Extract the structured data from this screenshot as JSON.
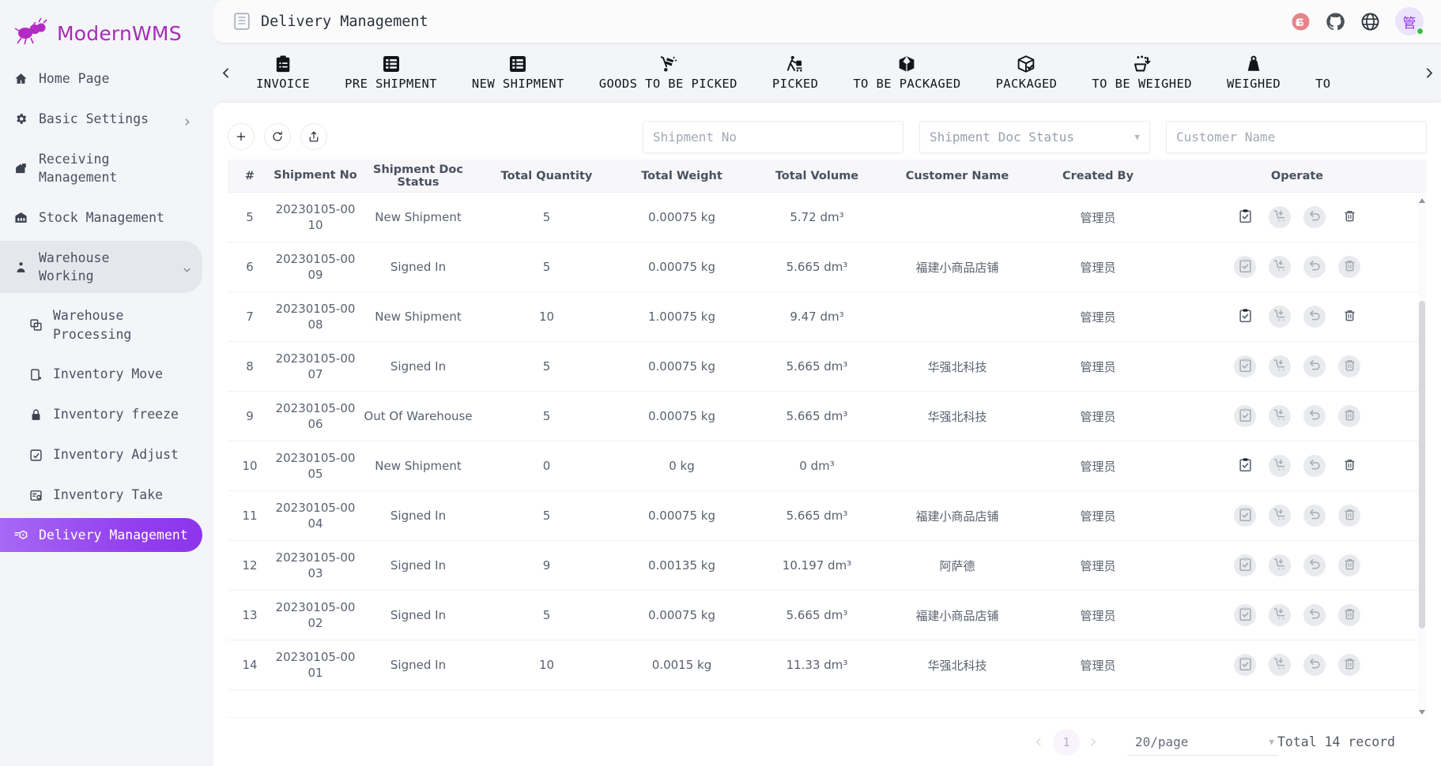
{
  "brand": {
    "name": "ModernWMS",
    "logo_icon": "ant-logo-icon",
    "accent": "#a82bb8"
  },
  "sidebar": {
    "items": [
      {
        "label": "Home Page",
        "icon": "home-icon",
        "state": "normal"
      },
      {
        "label": "Basic Settings",
        "icon": "gear-icon",
        "state": "normal",
        "caret": "chevron-right-icon"
      },
      {
        "label": "Receiving Management",
        "icon": "warehouse-in-icon",
        "state": "normal"
      },
      {
        "label": "Stock Management",
        "icon": "warehouse-icon",
        "state": "normal"
      },
      {
        "label": "Warehouse Working",
        "icon": "worker-icon",
        "state": "expanded",
        "caret": "chevron-down-icon"
      },
      {
        "label": "Warehouse Processing",
        "icon": "copy-icon",
        "state": "sub"
      },
      {
        "label": "Inventory Move",
        "icon": "move-icon",
        "state": "sub"
      },
      {
        "label": "Inventory freeze",
        "icon": "lock-icon",
        "state": "sub"
      },
      {
        "label": "Inventory Adjust",
        "icon": "adjust-icon",
        "state": "sub"
      },
      {
        "label": "Inventory Take",
        "icon": "take-icon",
        "state": "sub"
      },
      {
        "label": "Delivery Management",
        "icon": "delivery-icon",
        "state": "active"
      }
    ],
    "active_accent": "#9340ee"
  },
  "topbar": {
    "title": "Delivery Management",
    "title_icon": "document-icon",
    "icons": [
      {
        "name": "gitee-icon",
        "color": "#e8838b"
      },
      {
        "name": "github-icon",
        "color": "#4b5159"
      },
      {
        "name": "language-globe-icon",
        "color": "#2f343d"
      }
    ],
    "avatar_text": "管",
    "avatar_status": "online"
  },
  "tabs": {
    "prev_icon": "chevron-left-icon",
    "next_icon": "chevron-right-icon",
    "items": [
      {
        "label": "INVOICE",
        "icon": "clipboard-list-icon",
        "active": true
      },
      {
        "label": "PRE SHIPMENT",
        "icon": "list-grid-icon",
        "active": false
      },
      {
        "label": "NEW SHIPMENT",
        "icon": "list-grid-icon",
        "active": false
      },
      {
        "label": "GOODS TO BE PICKED",
        "icon": "hand-truck-icon",
        "active": false
      },
      {
        "label": "PICKED",
        "icon": "worker-cart-icon",
        "active": false
      },
      {
        "label": "TO BE PACKAGED",
        "icon": "open-box-icon",
        "active": false
      },
      {
        "label": "PACKAGED",
        "icon": "box-check-icon",
        "active": false
      },
      {
        "label": "TO BE WEIGHED",
        "icon": "scale-in-icon",
        "active": false
      },
      {
        "label": "WEIGHED",
        "icon": "weight-icon",
        "active": false
      },
      {
        "label": "TO",
        "icon": "",
        "active": false
      }
    ]
  },
  "toolbar": {
    "buttons": [
      {
        "name": "add-button",
        "icon": "plus-icon"
      },
      {
        "name": "refresh-button",
        "icon": "refresh-icon"
      },
      {
        "name": "export-button",
        "icon": "export-icon"
      }
    ],
    "filters": {
      "shipment_no_placeholder": "Shipment No",
      "shipment_no_value": "",
      "doc_status_placeholder": "Shipment Doc Status",
      "doc_status_value": "",
      "customer_name_placeholder": "Customer Name",
      "customer_name_value": ""
    }
  },
  "table": {
    "columns": [
      "#",
      "Shipment No",
      "Shipment Doc Status",
      "Total Quantity",
      "Total Weight",
      "Total Volume",
      "Customer Name",
      "Created By",
      "Operate"
    ],
    "rows": [
      {
        "idx": "5",
        "shipment_no": "20230105-0010",
        "status": "New Shipment",
        "qty": "5",
        "weight": "0.00075 kg",
        "volume": "5.72 dm³",
        "customer": "",
        "created_by": "管理员",
        "ops_enabled": true
      },
      {
        "idx": "6",
        "shipment_no": "20230105-0009",
        "status": "Signed In",
        "qty": "5",
        "weight": "0.00075 kg",
        "volume": "5.665 dm³",
        "customer": "福建小商品店铺",
        "created_by": "管理员",
        "ops_enabled": false
      },
      {
        "idx": "7",
        "shipment_no": "20230105-0008",
        "status": "New Shipment",
        "qty": "10",
        "weight": "1.00075 kg",
        "volume": "9.47 dm³",
        "customer": "",
        "created_by": "管理员",
        "ops_enabled": true
      },
      {
        "idx": "8",
        "shipment_no": "20230105-0007",
        "status": "Signed In",
        "qty": "5",
        "weight": "0.00075 kg",
        "volume": "5.665 dm³",
        "customer": "华强北科技",
        "created_by": "管理员",
        "ops_enabled": false
      },
      {
        "idx": "9",
        "shipment_no": "20230105-0006",
        "status": "Out Of Warehouse",
        "qty": "5",
        "weight": "0.00075 kg",
        "volume": "5.665 dm³",
        "customer": "华强北科技",
        "created_by": "管理员",
        "ops_enabled": false
      },
      {
        "idx": "10",
        "shipment_no": "20230105-0005",
        "status": "New Shipment",
        "qty": "0",
        "weight": "0 kg",
        "volume": "0 dm³",
        "customer": "",
        "created_by": "管理员",
        "ops_enabled": true
      },
      {
        "idx": "11",
        "shipment_no": "20230105-0004",
        "status": "Signed In",
        "qty": "5",
        "weight": "0.00075 kg",
        "volume": "5.665 dm³",
        "customer": "福建小商品店铺",
        "created_by": "管理员",
        "ops_enabled": false
      },
      {
        "idx": "12",
        "shipment_no": "20230105-0003",
        "status": "Signed In",
        "qty": "9",
        "weight": "0.00135 kg",
        "volume": "10.197 dm³",
        "customer": "阿萨德",
        "created_by": "管理员",
        "ops_enabled": false
      },
      {
        "idx": "13",
        "shipment_no": "20230105-0002",
        "status": "Signed In",
        "qty": "5",
        "weight": "0.00075 kg",
        "volume": "5.665 dm³",
        "customer": "福建小商品店铺",
        "created_by": "管理员",
        "ops_enabled": false
      },
      {
        "idx": "14",
        "shipment_no": "20230105-0001",
        "status": "Signed In",
        "qty": "10",
        "weight": "0.0015 kg",
        "volume": "11.33 dm³",
        "customer": "华强北科技",
        "created_by": "管理员",
        "ops_enabled": false
      }
    ],
    "operate_icons": [
      "clipboard-check-icon",
      "cart-down-icon",
      "undo-icon",
      "trash-icon"
    ]
  },
  "pagination": {
    "prev_icon": "chevron-left-icon",
    "next_icon": "chevron-right-icon",
    "current_page": "1",
    "page_size": "20/page",
    "total_text": "Total 14 record"
  }
}
